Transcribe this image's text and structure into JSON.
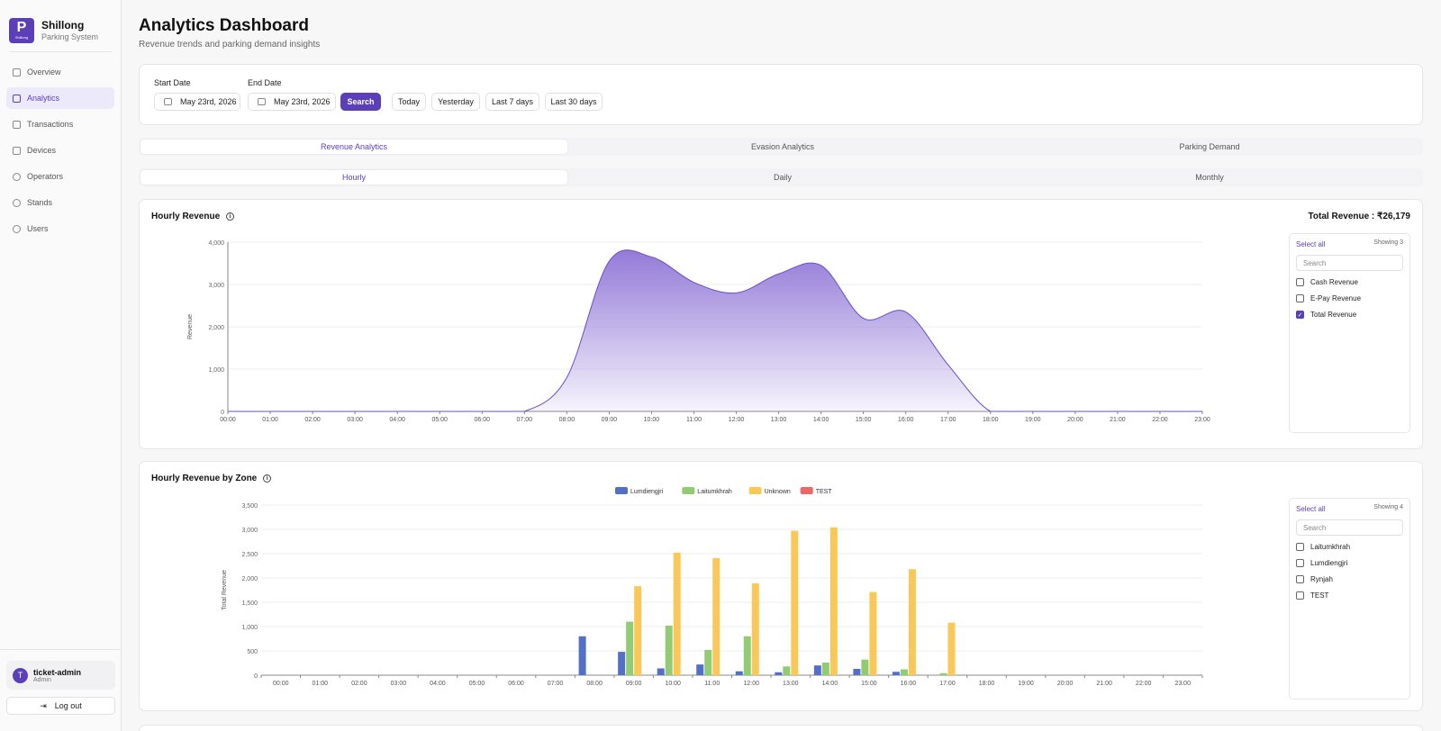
{
  "brand": {
    "logo_letter": "P",
    "logo_sub": "Shillong",
    "name": "Shillong",
    "subtitle": "Parking System"
  },
  "nav": [
    {
      "label": "Overview",
      "icon": "grid-icon"
    },
    {
      "label": "Analytics",
      "icon": "chart-icon",
      "active": true
    },
    {
      "label": "Transactions",
      "icon": "receipt-icon"
    },
    {
      "label": "Devices",
      "icon": "device-icon"
    },
    {
      "label": "Operators",
      "icon": "operators-icon"
    },
    {
      "label": "Stands",
      "icon": "map-pin-icon"
    },
    {
      "label": "Users",
      "icon": "users-icon"
    }
  ],
  "user": {
    "initial": "T",
    "name": "ticket-admin",
    "role": "Admin"
  },
  "logout_label": "Log out",
  "page": {
    "title": "Analytics Dashboard",
    "subtitle": "Revenue trends and parking demand insights"
  },
  "filters": {
    "start_label": "Start Date",
    "start_value": "May 23rd, 2026",
    "end_label": "End Date",
    "end_value": "May 23rd, 2026",
    "search_label": "Search",
    "quick": [
      "Today",
      "Yesterday",
      "Last 7 days",
      "Last 30 days"
    ]
  },
  "tabs": [
    "Revenue Analytics",
    "Evasion Analytics",
    "Parking Demand"
  ],
  "subtabs": [
    "Hourly",
    "Daily",
    "Monthly"
  ],
  "colors": {
    "accent": "#5b3fb8",
    "area": "#8e73d6",
    "lumdiengjri": "#5470c6",
    "laitumkhrah": "#91cc75",
    "unknown": "#fac858",
    "test": "#ee6666"
  },
  "hourly_card": {
    "title": "Hourly Revenue",
    "total_label": "Total Revenue : ₹26,179",
    "panel": {
      "select_all": "Select all",
      "showing": "Showing 3",
      "search_placeholder": "Search",
      "items": [
        {
          "label": "Cash Revenue",
          "checked": false
        },
        {
          "label": "E-Pay Revenue",
          "checked": false
        },
        {
          "label": "Total Revenue",
          "checked": true
        }
      ]
    }
  },
  "zone_card": {
    "title": "Hourly Revenue by Zone",
    "panel": {
      "select_all": "Select all",
      "showing": "Showing 4",
      "search_placeholder": "Search",
      "items": [
        {
          "label": "Laitumkhrah",
          "checked": false
        },
        {
          "label": "Lumdiengjri",
          "checked": false
        },
        {
          "label": "Rynjah",
          "checked": false
        },
        {
          "label": "TEST",
          "checked": false
        }
      ]
    }
  },
  "chart_data": [
    {
      "type": "area",
      "ylabel": "Revenue",
      "ylim": [
        0,
        4000
      ],
      "yticks": [
        "0",
        "1,000",
        "2,000",
        "3,000",
        "4,000"
      ],
      "categories": [
        "00:00",
        "01:00",
        "02:00",
        "03:00",
        "04:00",
        "05:00",
        "06:00",
        "07:00",
        "08:00",
        "09:00",
        "10:00",
        "11:00",
        "12:00",
        "13:00",
        "14:00",
        "15:00",
        "16:00",
        "17:00",
        "18:00",
        "19:00",
        "20:00",
        "21:00",
        "22:00",
        "23:00"
      ],
      "values": [
        0,
        0,
        0,
        0,
        0,
        0,
        0,
        0,
        800,
        3550,
        3650,
        3050,
        2800,
        3250,
        3450,
        2200,
        2350,
        1100,
        0,
        0,
        0,
        0,
        0,
        0
      ]
    },
    {
      "type": "bar",
      "ylabel": "Total Revenue",
      "ylim": [
        0,
        3500
      ],
      "yticks": [
        "0",
        "500",
        "1,000",
        "1,500",
        "2,000",
        "2,500",
        "3,000",
        "3,500"
      ],
      "categories": [
        "00:00",
        "01:00",
        "02:00",
        "03:00",
        "04:00",
        "05:00",
        "06:00",
        "07:00",
        "08:00",
        "09:00",
        "10:00",
        "11:00",
        "12:00",
        "13:00",
        "14:00",
        "15:00",
        "16:00",
        "17:00",
        "18:00",
        "19:00",
        "20:00",
        "21:00",
        "22:00",
        "23:00"
      ],
      "series": [
        {
          "name": "Lumdiengjri",
          "color": "#5470c6",
          "values": [
            0,
            0,
            0,
            0,
            0,
            0,
            0,
            0,
            800,
            480,
            140,
            220,
            80,
            60,
            200,
            130,
            70,
            0,
            0,
            0,
            0,
            0,
            0,
            0
          ]
        },
        {
          "name": "Laitumkhrah",
          "color": "#91cc75",
          "values": [
            0,
            0,
            0,
            0,
            0,
            0,
            0,
            0,
            0,
            1100,
            1020,
            520,
            800,
            180,
            260,
            320,
            120,
            40,
            0,
            0,
            0,
            0,
            0,
            0
          ]
        },
        {
          "name": "Unknown",
          "color": "#fac858",
          "values": [
            0,
            0,
            0,
            0,
            0,
            0,
            0,
            0,
            0,
            1830,
            2520,
            2410,
            1890,
            2970,
            3040,
            1710,
            2180,
            1080,
            0,
            0,
            0,
            0,
            0,
            0
          ]
        },
        {
          "name": "TEST",
          "color": "#ee6666",
          "values": [
            0,
            0,
            0,
            0,
            0,
            0,
            0,
            0,
            0,
            0,
            0,
            0,
            0,
            0,
            0,
            0,
            0,
            0,
            0,
            0,
            0,
            0,
            0,
            0
          ]
        }
      ]
    }
  ]
}
